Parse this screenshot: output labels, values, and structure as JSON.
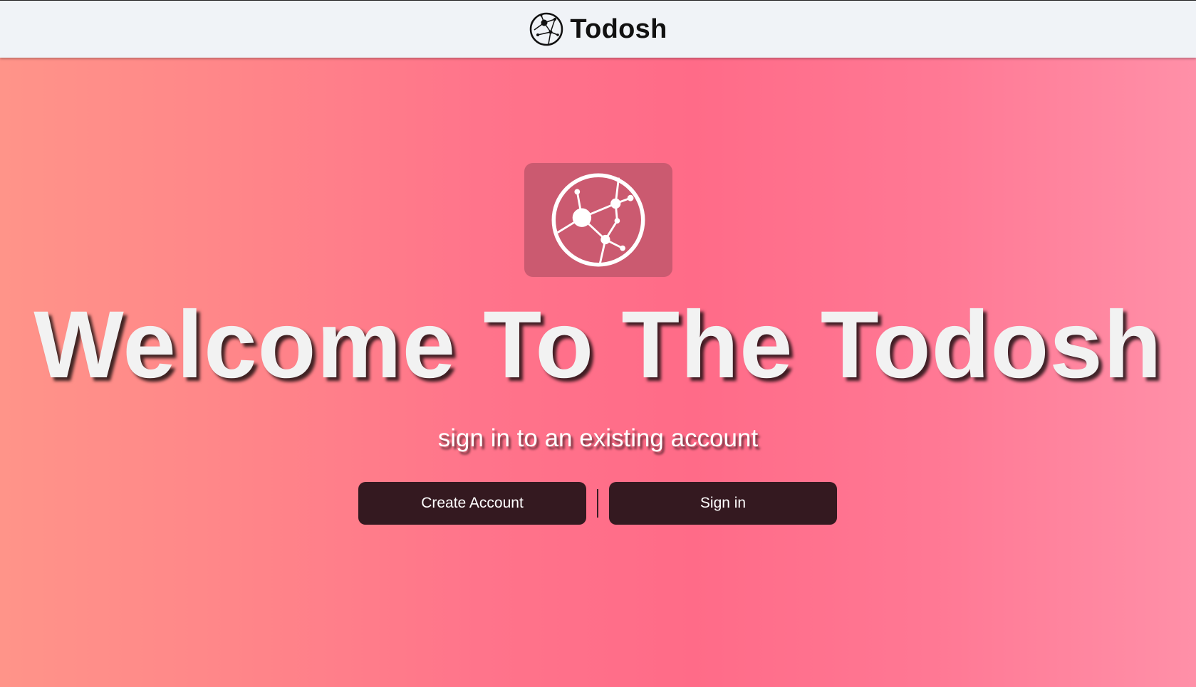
{
  "header": {
    "brand_name": "Todosh",
    "logo_icon": "network-globe-icon"
  },
  "hero": {
    "logo_icon": "network-globe-icon",
    "title": "Welcome To The Todosh",
    "subtitle": "sign in to an existing account",
    "create_account_label": "Create Account",
    "sign_in_label": "Sign in"
  },
  "colors": {
    "header_background": "#f0f3f7",
    "gradient_left": "#ff9489",
    "gradient_center": "#ff6b88",
    "gradient_right": "#ff90a8",
    "logo_box": "#cb5a70",
    "button_background": "#341920",
    "button_text": "#ffffff",
    "title_text": "#f2f2f2"
  }
}
